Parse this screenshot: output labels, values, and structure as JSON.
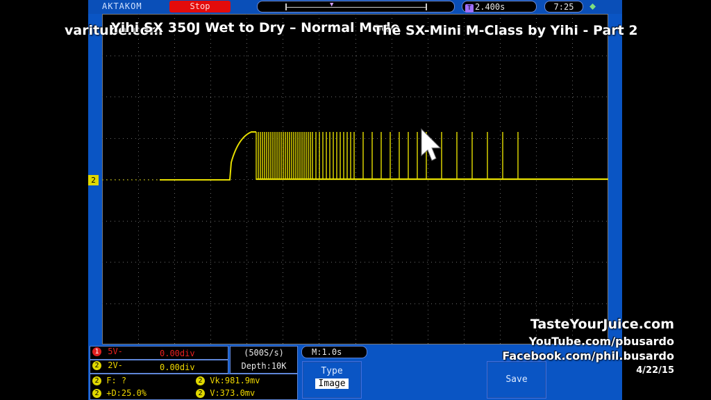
{
  "scope": {
    "brand": "AKTAKOM",
    "run_state": "Stop",
    "timebase": "2.400s",
    "clock": "7:25",
    "channel_marker": "2"
  },
  "overlays": {
    "left_site": "varitube.com",
    "video_title_1": "Yihi SX 350J Wet to Dry – Normal Mode",
    "video_title_2": "The SX-Mini M-Class by Yihi - Part 2",
    "credit_site": "TasteYourJuice.com",
    "credit_youtube": "YouTube.com/pbusardo",
    "credit_facebook": "Facebook.com/phil.busardo",
    "credit_date": "4/22/15"
  },
  "channels": {
    "ch1": {
      "label": "5V-",
      "offset": "0.00div"
    },
    "ch2": {
      "label": "2V-",
      "offset": "0.00div"
    }
  },
  "acquisition": {
    "rate": "(500S/s)",
    "depth": "Depth:10K",
    "main_time": "M:1.0s"
  },
  "measurements": {
    "freq": "F:  ?",
    "duty": "+D:25.0%",
    "vpeak": "Vk:981.9mv",
    "vavg": "V:373.0mv"
  },
  "menu": {
    "type_label": "Type",
    "type_value": "Image",
    "save_label": "Save"
  },
  "colors": {
    "trace": "#e8e000",
    "screen_bg": "#000000",
    "frame": "#0a55c4",
    "stop_button": "#e30b0b"
  }
}
